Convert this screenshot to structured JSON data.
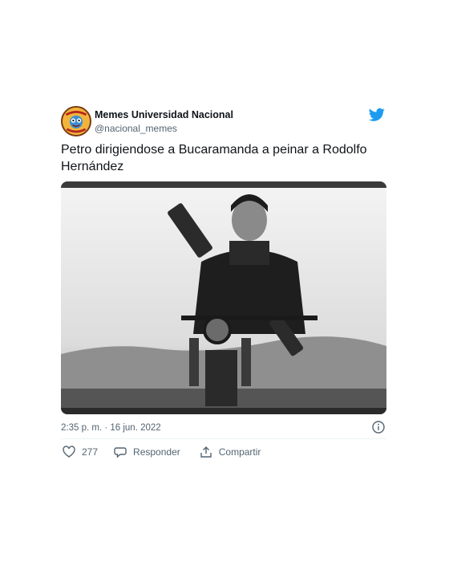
{
  "tweet": {
    "display_name": "Memes Universidad Nacional",
    "handle": "@nacional_memes",
    "avatar_text": "MEMES UNACIONAL",
    "text": "Petro dirigiendose a Bucaramanda a peinar a Rodolfo Hernández",
    "timestamp": "2:35 p. m. · 16 jun. 2022",
    "like_count": "277",
    "reply_label": "Responder",
    "share_label": "Compartir"
  },
  "icons": {
    "brand": "twitter-bird-icon",
    "info": "info-icon",
    "like": "heart-icon",
    "reply": "speech-bubble-icon",
    "share": "share-icon"
  },
  "colors": {
    "twitter_blue": "#1d9bf0",
    "secondary_text": "#536471",
    "primary_text": "#0f1419"
  }
}
